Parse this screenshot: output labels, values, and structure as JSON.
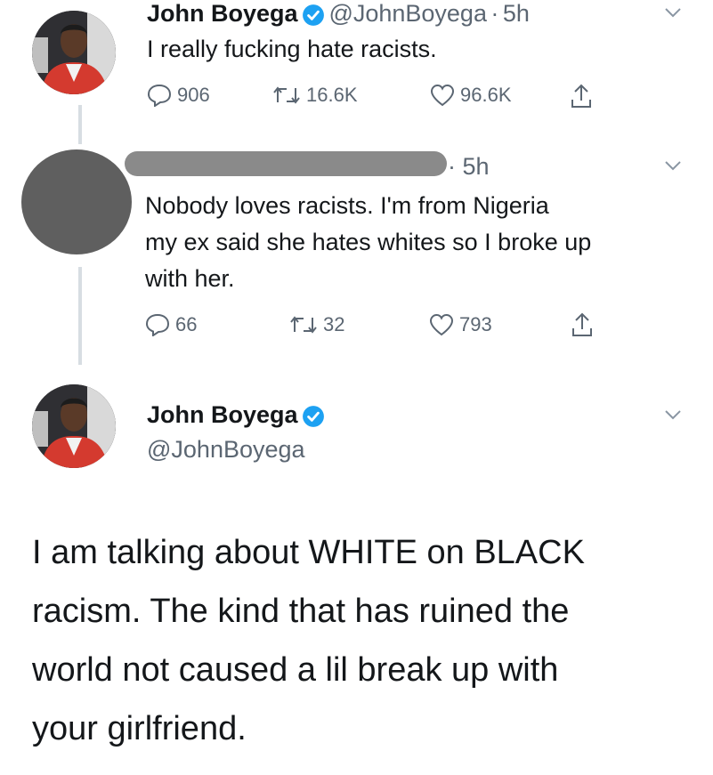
{
  "tweets": [
    {
      "name": "John Boyega",
      "handle": "@JohnBoyega",
      "time_sep": "·",
      "time": "5h",
      "text": "I really fucking hate racists.",
      "replies": "906",
      "retweets": "16.6K",
      "likes": "96.6K"
    },
    {
      "time_sep": "·",
      "time": "5h",
      "text_lines": [
        "Nobody loves racists. I'm from Nigeria",
        "my ex said she hates whites so I broke up",
        "with her."
      ],
      "replies": "66",
      "retweets": "32",
      "likes": "793"
    },
    {
      "name": "John Boyega",
      "handle": "@JohnBoyega",
      "text_lines": [
        "I am talking about WHITE on BLACK",
        "racism. The kind that has ruined the",
        "world not caused a lil break up with",
        "your girlfriend."
      ]
    }
  ],
  "colors": {
    "verified_blue": "#1da1f2",
    "secondary_text": "#5b6672",
    "thread_line": "#d7dde2"
  },
  "icons": [
    "reply-icon",
    "retweet-icon",
    "like-icon",
    "share-icon",
    "verified-badge-icon",
    "chevron-down-icon"
  ]
}
